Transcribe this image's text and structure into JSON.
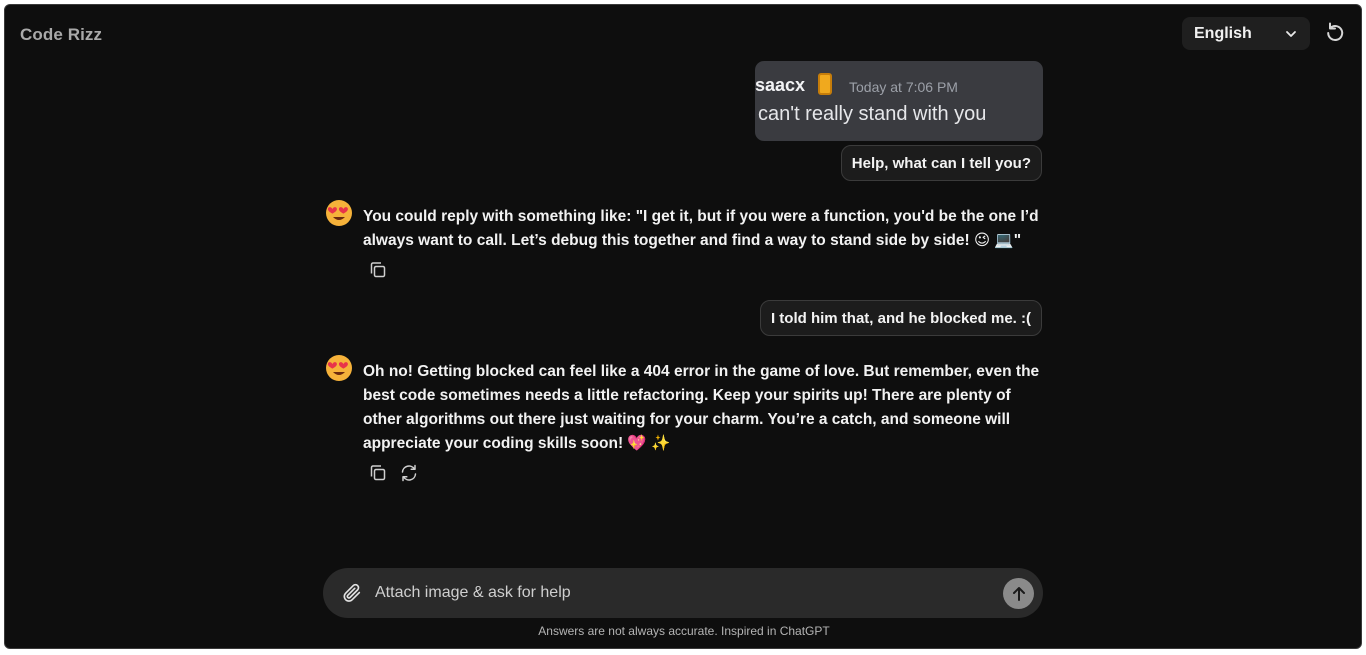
{
  "app": {
    "title": "Code Rizz"
  },
  "header": {
    "language": "English"
  },
  "screenshot": {
    "username": "saacx",
    "timestamp": "Today at 7:06 PM",
    "message": "can't really stand with you"
  },
  "messages": [
    {
      "role": "user",
      "text": "Help, what can I tell you?"
    },
    {
      "role": "assistant",
      "text": "You could reply with something like: \"I get it, but if you were a function, you'd be the one I’d always want to call. Let’s debug this together and find a way to stand side by side! 😉 💻\""
    },
    {
      "role": "user",
      "text": "I told him that, and he blocked me. :("
    },
    {
      "role": "assistant",
      "text": "Oh no! Getting blocked can feel like a 404 error in the game of love. But remember, even the best code sometimes needs a little refactoring. Keep your spirits up! There are plenty of other algorithms out there just waiting for your charm. You’re a catch, and someone will appreciate your coding skills soon! 💖 ✨"
    }
  ],
  "composer": {
    "placeholder": "Attach image & ask for help"
  },
  "footer": {
    "disclaimer": "Answers are not always accurate. Inspired in ChatGPT"
  },
  "icons": {
    "avatar": "heart-eyes-emoji-icon",
    "copy": "copy-icon",
    "regenerate": "refresh-icon",
    "attach": "paperclip-icon",
    "send": "arrow-up-icon",
    "reset": "reset-icon",
    "dropdown": "chevron-down-icon"
  },
  "colors": {
    "background": "#0e0e0e",
    "bubble": "#1c1c1c",
    "composer": "#2a2a2a"
  }
}
